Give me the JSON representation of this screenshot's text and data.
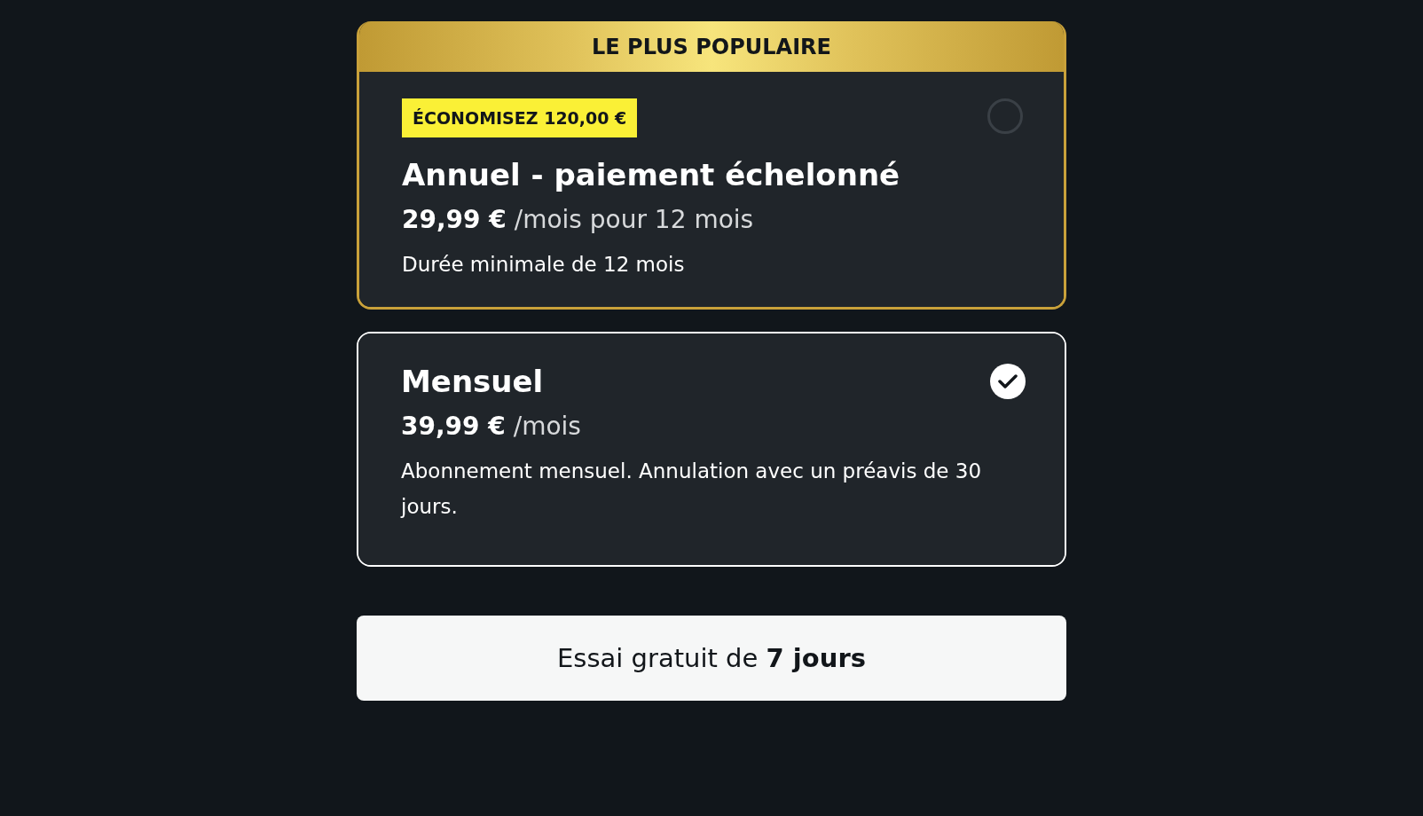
{
  "plans": [
    {
      "banner": "LE PLUS POPULAIRE",
      "badge": "ÉCONOMISEZ 120,00 €",
      "title": "Annuel - paiement échelonné",
      "price": "29,99 €",
      "period": "/mois pour 12 mois",
      "note": "Durée minimale de 12 mois",
      "selected": false
    },
    {
      "title": "Mensuel",
      "price": "39,99 €",
      "period": "/mois",
      "note": "Abonnement mensuel. Annulation avec un préavis de 30 jours.",
      "selected": true
    }
  ],
  "cta": "Essai gratuit de **7 jours**"
}
